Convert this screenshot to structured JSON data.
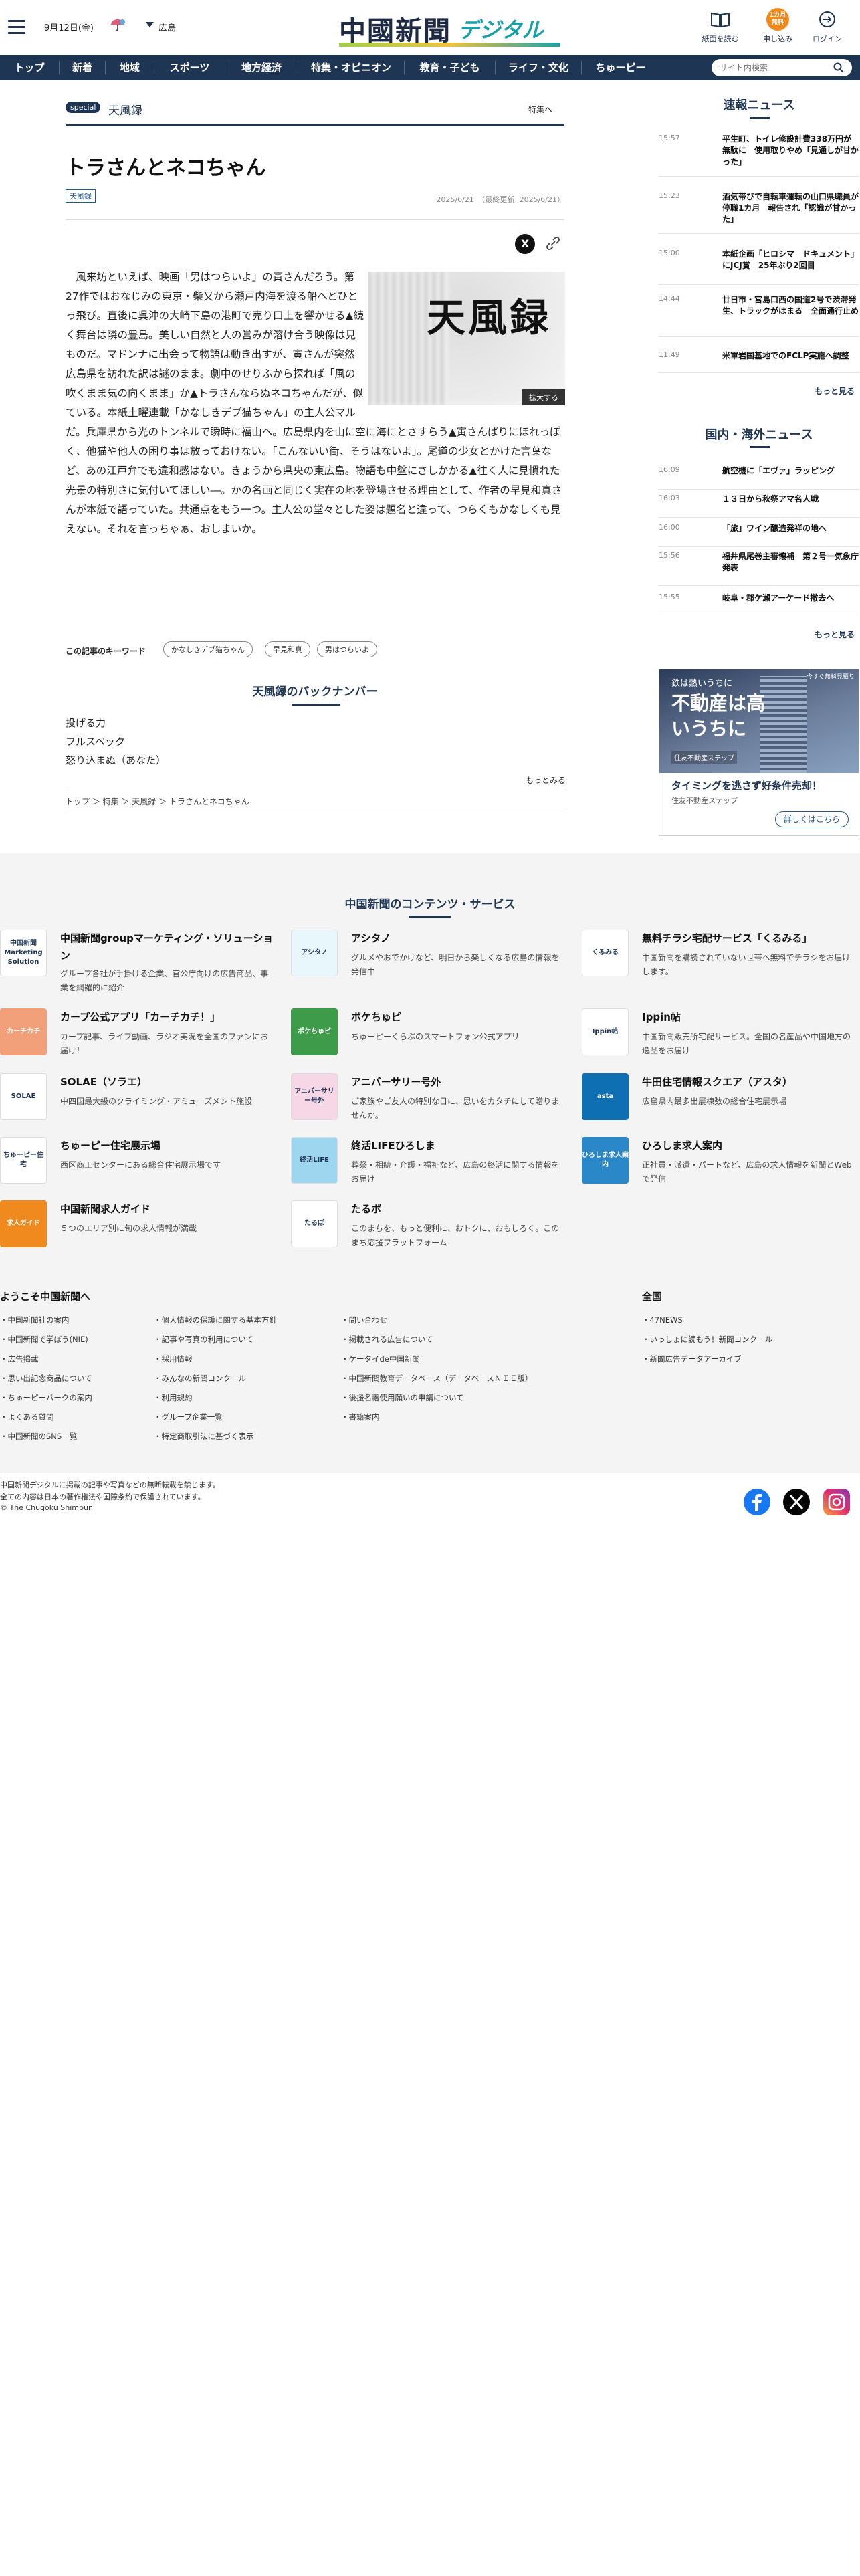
{
  "header": {
    "date": "9月12日(金)",
    "area": "広島",
    "logo_main": "中國新聞",
    "logo_sub": "デジタル",
    "buttons": [
      {
        "label": "紙面を読む"
      },
      {
        "label": "申し込み",
        "badge": "1カ月 無料"
      },
      {
        "label": "ログイン"
      }
    ]
  },
  "nav": {
    "items": [
      "トップ",
      "新着",
      "地域",
      "スポーツ",
      "地方経済",
      "特集・オピニオン",
      "教育・子ども",
      "ライフ・文化",
      "ちゅーピー"
    ],
    "search_placeholder": "サイト内検索"
  },
  "article": {
    "special_badge": "special",
    "special_title": "天風録",
    "special_link": "特集へ",
    "title": "トラさんとネコちゃん",
    "tag": "天風録",
    "date": "2025/6/21　（最終更新: 2025/6/21）",
    "figure_caption": "天風録",
    "zoom_label": "拡大する",
    "body": "　風来坊といえば、映画「男はつらいよ」の寅さんだろう。第27作ではおなじみの東京・柴又から瀬戸内海を渡る船へとひとっ飛び。直後に呉沖の大崎下島の港町で売り口上を響かせる▲続く舞台は隣の豊島。美しい自然と人の営みが溶け合う映像は見ものだ。マドンナに出会って物語は動き出すが、寅さんが突然広島県を訪れた訳は謎のまま。劇中のせりふから探れば「風の吹くまま気の向くまま」か▲トラさんならぬネコちゃんだが、似ている。本紙土曜連載「かなしきデブ猫ちゃん」の主人公マルだ。兵庫県から光のトンネルで瞬時に福山へ。広島県内を山に空に海にとさすらう▲寅さんばりにほれっぽく、他猫や他人の困り事は放っておけない。「こんないい街、そうはないよ」。尾道の少女とかけた言葉など、あの江戸弁でも違和感はない。きょうから県央の東広島。物語も中盤にさしかかる▲往く人に見慣れた光景の特別さに気付いてほしい―。かの名画と同じく実在の地を登場させる理由として、作者の早見和真さんが本紙で語っていた。共通点をもう一つ。主人公の堂々とした姿は題名と違って、つらくもかなしくも見えない。それを言っちゃぁ、おしまいか。",
    "keywords_label": "この記事のキーワード",
    "keywords": [
      "かなしきデブ猫ちゃん",
      "早見和真",
      "男はつらいよ"
    ],
    "backnumber_title": "天風録のバックナンバー",
    "backnumbers": [
      "投げる力",
      "フルスペック",
      "怒り込まぬ（あなた）"
    ],
    "more_label": "もっとみる",
    "breadcrumb": "トップ ＞ 特集 ＞ 天風録 ＞ トラさんとネコちゃん"
  },
  "sidebar": {
    "breaking_title": "速報ニュース",
    "breaking": [
      {
        "time": "15:57",
        "headline": "平生町、トイレ修設計費338万円が無駄に　使用取りやめ「見通しが甘かった」"
      },
      {
        "time": "15:23",
        "headline": "酒気帯びで自転車運転の山口県職員が停職1カ月　報告され「認識が甘かった」"
      },
      {
        "time": "15:00",
        "headline": "本紙企画「ヒロシマ　ドキュメント」にJCJ賞　25年ぶり2回目"
      },
      {
        "time": "14:44",
        "headline": "廿日市・宮島口西の国道2号で渋滞発生、トラックがはまる　全面通行止め"
      },
      {
        "time": "11:49",
        "headline": "米軍岩国基地でのFCLP実施へ調整"
      }
    ],
    "domestic_title": "国内・海外ニュース",
    "domestic": [
      {
        "time": "16:09",
        "headline": "航空機に「エヴァ」ラッピング"
      },
      {
        "time": "16:03",
        "headline": "１３日から秋祭アマ名人戦"
      },
      {
        "time": "16:00",
        "headline": "「旅」ワイン醸造発祥の地へ"
      },
      {
        "time": "15:56",
        "headline": "福井県尾巻主審懐補　第２号一気象庁発表"
      },
      {
        "time": "15:55",
        "headline": "岐阜・郡ケ瀬アーケード撤去へ"
      }
    ],
    "more": "もっと見る",
    "ad": {
      "corner": "今すぐ無料見積り",
      "line1": "鉄は熱いうちに",
      "line2": "不動産は高いうちに",
      "logo": "住友不動産ステップ",
      "text": "タイミングを逃さず好条件売却！",
      "sub": "住友不動産ステップ",
      "button": "詳しくはこちら"
    }
  },
  "services": {
    "title": "中国新聞のコンテンツ・サービス",
    "items": [
      {
        "name": "中国新聞groupマーケティング・ソリューション",
        "desc": "グループ各社が手掛ける企業、官公庁向けの広告商品、事業を網羅的に紹介",
        "icon": "中国新聞 Marketing Solution",
        "color": "#ffffff"
      },
      {
        "name": "アシタノ",
        "desc": "グルメやおでかけなど、明日から楽しくなる広島の情報を発信中",
        "icon": "アシタノ",
        "color": "#e8f7fb"
      },
      {
        "name": "無料チラシ宅配サービス「くるみる」",
        "desc": "中国新聞を購読されていない世帯へ無料でチラシをお届けします。",
        "icon": "くるみる",
        "color": "#ffffff"
      },
      {
        "name": "カープ公式アプリ「カーチカチ！」",
        "desc": "カープ記事、ライブ動画、ラジオ実況を全国のファンにお届け！",
        "icon": "カーチカチ",
        "color": "#f2a07a"
      },
      {
        "name": "ポケちゅピ",
        "desc": "ちゅーピーくらぶのスマートフォン公式アプリ",
        "icon": "ポケちゅピ",
        "color": "#3d9b4a"
      },
      {
        "name": "Ippin帖",
        "desc": "中国新聞販売所宅配サービス。全国の名産品や中国地方の逸品をお届け",
        "icon": "Ippin帖",
        "color": "#ffffff"
      },
      {
        "name": "SOLAE（ソラエ）",
        "desc": "中四国最大級のクライミング・アミューズメント施設",
        "icon": "SOLAE",
        "color": "#ffffff"
      },
      {
        "name": "アニバーサリー号外",
        "desc": "ご家族やご友人の特別な日に、思いをカタチにして贈りませんか。",
        "icon": "アニバーサリー号外",
        "color": "#f7d6e6"
      },
      {
        "name": "牛田住宅情報スクエア（アスタ）",
        "desc": "広島県内最多出展棟数の総合住宅展示場",
        "icon": "asta",
        "color": "#0f6fb3"
      },
      {
        "name": "ちゅーピー住宅展示場",
        "desc": "西区商工センターにある総合住宅展示場です",
        "icon": "ちゅーピー住宅",
        "color": "#ffffff"
      },
      {
        "name": "終活LIFEひろしま",
        "desc": "葬祭・相続・介護・福祉など、広島の終活に関する情報をお届け",
        "icon": "終活LIFE",
        "color": "#9fd6ef"
      },
      {
        "name": "ひろしま求人案内",
        "desc": "正社員・派遣・パートなど、広島の求人情報を新聞とWebで発信",
        "icon": "ひろしま求人案内",
        "color": "#2a88c8"
      },
      {
        "name": "中国新聞求人ガイド",
        "desc": "５つのエリア別に旬の求人情報が満載",
        "icon": "求人ガイド",
        "color": "#f08a1e"
      },
      {
        "name": "たるポ",
        "desc": "このまちを、もっと便利に、おトクに、おもしろく。このまち応援プラットフォーム",
        "icon": "たるぽ",
        "color": "#ffffff"
      }
    ]
  },
  "welcome": {
    "title": "ようこそ中国新聞へ",
    "col1": [
      "中国新聞社の案内",
      "中国新聞で学ぼう(NIE)",
      "広告掲載",
      "思い出記念商品について",
      "ちゅーピーパークの案内",
      "よくある質問",
      "中国新聞のSNS一覧"
    ],
    "col2": [
      "個人情報の保護に関する基本方針",
      "記事や写真の利用について",
      "採用情報",
      "みんなの新聞コンクール",
      "利用規約",
      "グループ企業一覧",
      "特定商取引法に基づく表示"
    ],
    "col3": [
      "問い合わせ",
      "掲載される広告について",
      "ケータイde中国新聞",
      "中国新聞教育データベース（データベースＮＩＥ版）",
      "後援名義使用願いの申請について",
      "書籍案内"
    ],
    "national_title": "全国",
    "national": [
      "47NEWS",
      "いっしょに読もう！新聞コンクール",
      "新聞広告データアーカイブ"
    ]
  },
  "footer": {
    "line1": "中国新聞デジタルに掲載の記事や写真などの無断転載を禁じます。",
    "line2": "全ての内容は日本の著作権法や国際条約で保護されています。",
    "copyright": "© The Chugoku Shimbun"
  },
  "colors": {
    "navy": "#1f3554",
    "teal": "#1aa1a7",
    "facebook": "#1877f2"
  }
}
